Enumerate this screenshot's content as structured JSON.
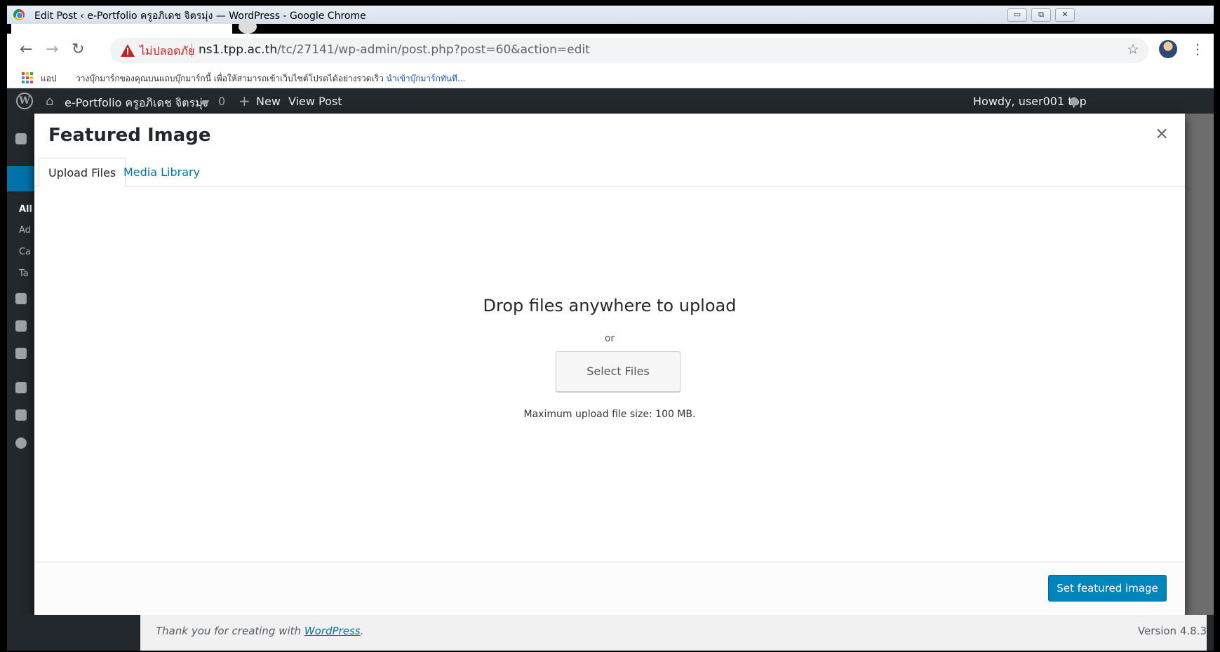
{
  "window": {
    "title": "Edit Post ‹ e-Portfolio ครูอภิเดช จิตรมุ่ง — WordPress - Google Chrome"
  },
  "browser": {
    "security_label": "ไม่ปลอดภัย",
    "url_host": "ns1.tpp.ac.th",
    "url_path": "/tc/27141/wp-admin/post.php?post=60&action=edit",
    "bookmarks": {
      "apps_label": "แอป",
      "hint": "วางบุ๊กมาร์กของคุณบนแถบบุ๊กมาร์กนี้ เพื่อให้สามารถเข้าเว็บไซต์โปรดได้อย่างรวดเร็ว",
      "import_link": "นำเข้าบุ๊กมาร์กทันที..."
    }
  },
  "adminbar": {
    "site_name": "e-Portfolio ครูอภิเดช จิตรมุ่ง",
    "comments_count": "0",
    "new_label": "New",
    "view_post_label": "View Post",
    "howdy": "Howdy, user001 tpp"
  },
  "adminmenu": {
    "sub_items": [
      "All",
      "Ad",
      "Ca",
      "Ta"
    ]
  },
  "modal": {
    "title": "Featured Image",
    "close_symbol": "×",
    "tabs": [
      {
        "label": "Upload Files",
        "active": true
      },
      {
        "label": "Media Library",
        "active": false
      }
    ],
    "drop_text": "Drop files anywhere to upload",
    "or_text": "or",
    "select_files_label": "Select Files",
    "max_size_text": "Maximum upload file size: 100 MB.",
    "set_button_label": "Set featured image"
  },
  "footer": {
    "thanks_prefix": "Thank you for creating with",
    "thanks_link": "WordPress",
    "thanks_suffix": ".",
    "version": "Version 4.8.3"
  },
  "colors": {
    "accent": "#0085ba",
    "admin_bar": "#23282d",
    "link": "#0073aa"
  }
}
